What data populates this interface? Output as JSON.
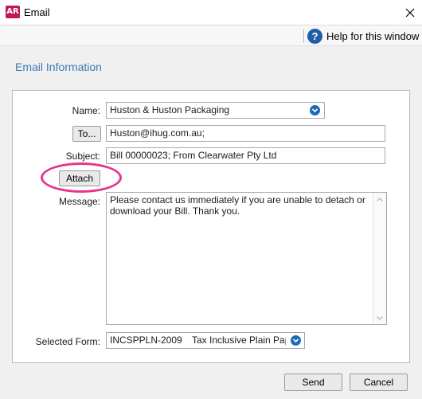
{
  "window": {
    "app_icon_text": "AR",
    "title": "Email"
  },
  "toolbar": {
    "help_label": "Help for this window"
  },
  "section": {
    "title": "Email Information"
  },
  "form": {
    "name_label": "Name:",
    "name_value": "Huston & Huston Packaging",
    "to_button": "To...",
    "to_value": "Huston@ihug.com.au;",
    "subject_label": "Subject:",
    "subject_value": "Bill 00000023; From Clearwater Pty Ltd",
    "attach_button": "Attach",
    "message_label": "Message:",
    "message_value": "Please contact us immediately if you are unable to detach or download your Bill. Thank you.",
    "form_label": "Selected Form:",
    "form_code": "INCSPPLN-2009",
    "form_name": "Tax Inclusive Plain Paper"
  },
  "buttons": {
    "send": "Send",
    "cancel": "Cancel"
  },
  "colors": {
    "accent": "#3d7ab5",
    "highlight": "#e5338f",
    "app_icon": "#c2185b"
  }
}
